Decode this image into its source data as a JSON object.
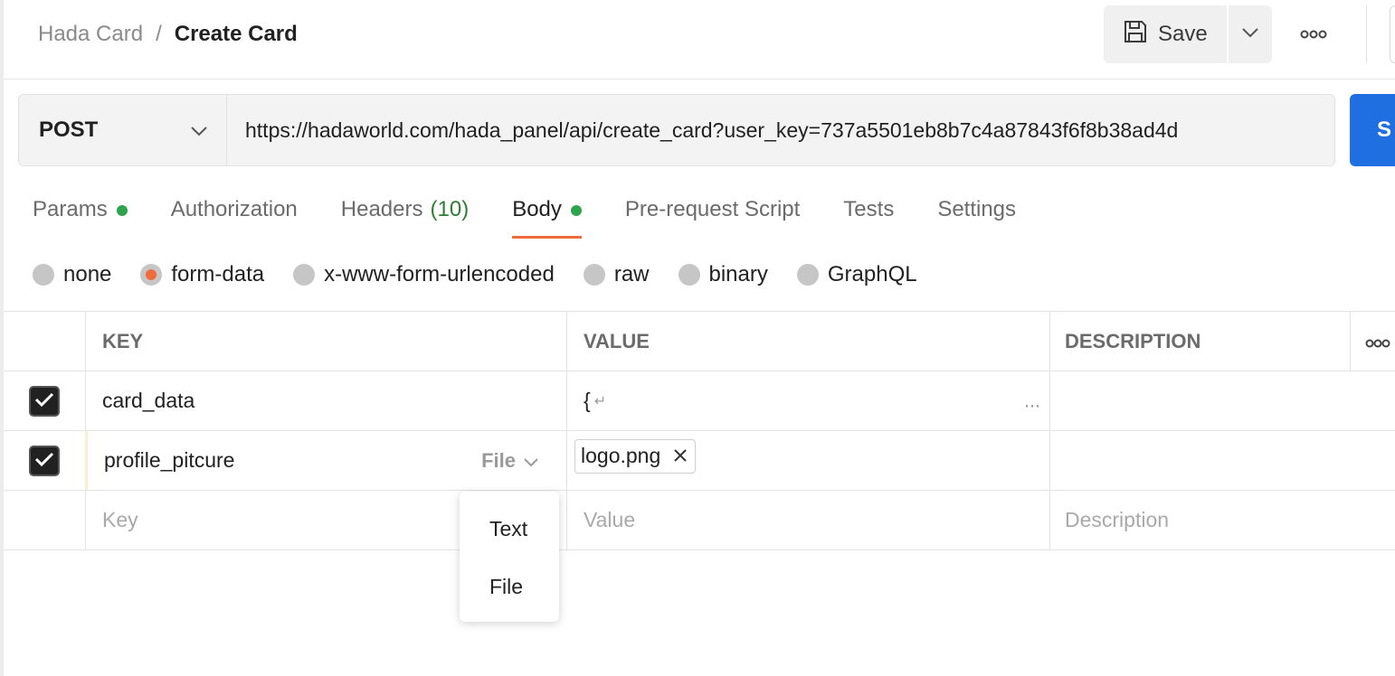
{
  "breadcrumb": {
    "parent": "Hada Card",
    "separator": "/",
    "current": "Create Card"
  },
  "toolbar": {
    "save_label": "Save"
  },
  "request": {
    "method": "POST",
    "url": "https://hadaworld.com/hada_panel/api/create_card?user_key=737a5501eb8b7c4a87843f6f8b38ad4d",
    "send_label": "S"
  },
  "tabs": [
    {
      "label": "Params",
      "count": ""
    },
    {
      "label": "Authorization",
      "count": ""
    },
    {
      "label": "Headers",
      "count": "(10)"
    },
    {
      "label": "Body",
      "count": ""
    },
    {
      "label": "Pre-request Script",
      "count": ""
    },
    {
      "label": "Tests",
      "count": ""
    },
    {
      "label": "Settings",
      "count": ""
    }
  ],
  "body_types": [
    "none",
    "form-data",
    "x-www-form-urlencoded",
    "raw",
    "binary",
    "GraphQL"
  ],
  "table": {
    "headers": {
      "key": "KEY",
      "value": "VALUE",
      "description": "DESCRIPTION"
    },
    "rows": [
      {
        "key": "card_data",
        "value": "{",
        "value_suffix": "↵",
        "description": ""
      },
      {
        "key": "profile_pitcure",
        "type": "File",
        "value": "logo.png",
        "description": ""
      }
    ],
    "new_row": {
      "key_placeholder": "Key",
      "value_placeholder": "Value",
      "description_placeholder": "Description"
    }
  },
  "type_menu": {
    "items": [
      "Text",
      "File"
    ]
  },
  "colors": {
    "accent": "#ef6c3d",
    "send": "#1f6fe0",
    "active_dot": "#2ea44f"
  }
}
